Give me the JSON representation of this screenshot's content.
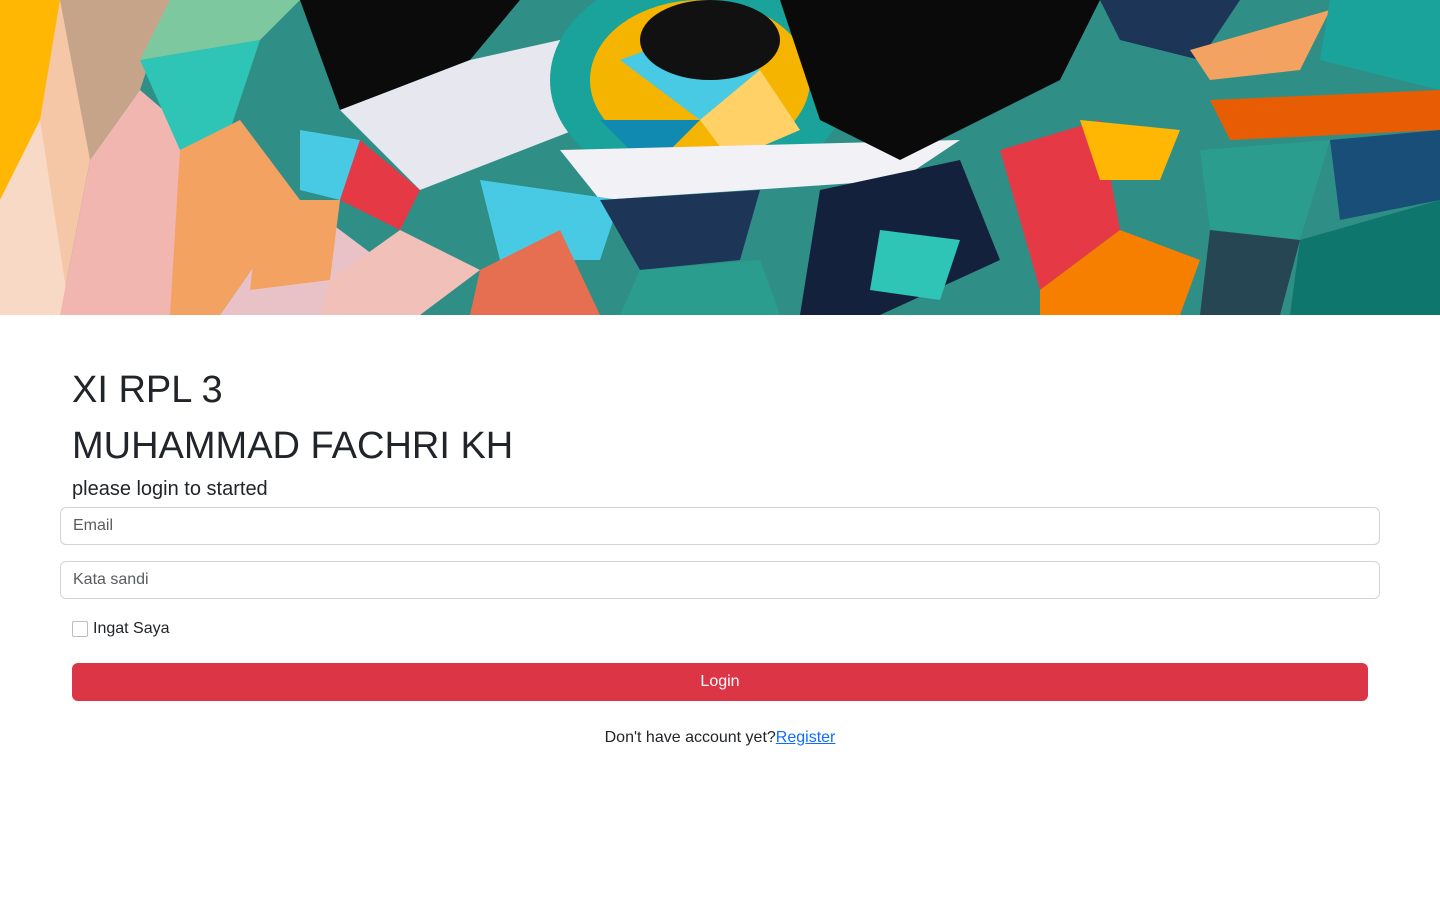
{
  "hero": {
    "image": "abstract-colorful-eye-painting",
    "palette": [
      "#2a9d8f",
      "#f4a261",
      "#e63946",
      "#1d3557",
      "#ffb703",
      "#48cae4",
      "#000000",
      "#f1c0b9"
    ]
  },
  "header": {
    "class_name": "XI RPL 3",
    "student_name": "MUHAMMAD FACHRI KH",
    "subtitle": "please login to started"
  },
  "form": {
    "email_placeholder": "Email",
    "email_value": "",
    "password_placeholder": "Kata sandi",
    "password_value": "",
    "remember_label": "Ingat Saya",
    "remember_checked": false,
    "login_label": "Login"
  },
  "footer": {
    "prompt": "Don't have account yet?",
    "register_label": "Register"
  },
  "colors": {
    "login_button": "#dc3545",
    "link": "#0d6efd",
    "text": "#212529"
  }
}
